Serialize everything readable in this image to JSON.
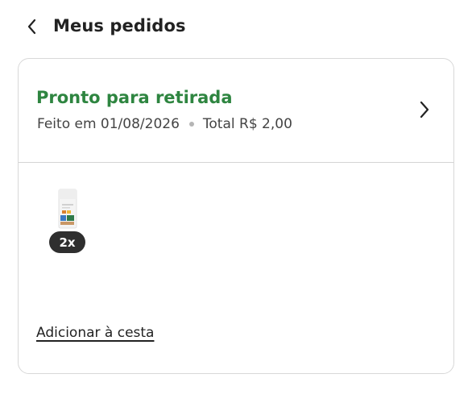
{
  "header": {
    "back_icon": "chevron-left-icon",
    "title": "Meus pedidos"
  },
  "order": {
    "status": "Pronto para retirada",
    "status_color": "#2e8540",
    "date_text": "Feito em 01/08/2026",
    "total_text": "Total R$ 2,00",
    "open_icon": "chevron-right-icon",
    "items": [
      {
        "image_icon": "sunscreen-bottle-icon",
        "quantity_label": "2x"
      }
    ],
    "add_to_cart_label": "Adicionar à cesta"
  }
}
